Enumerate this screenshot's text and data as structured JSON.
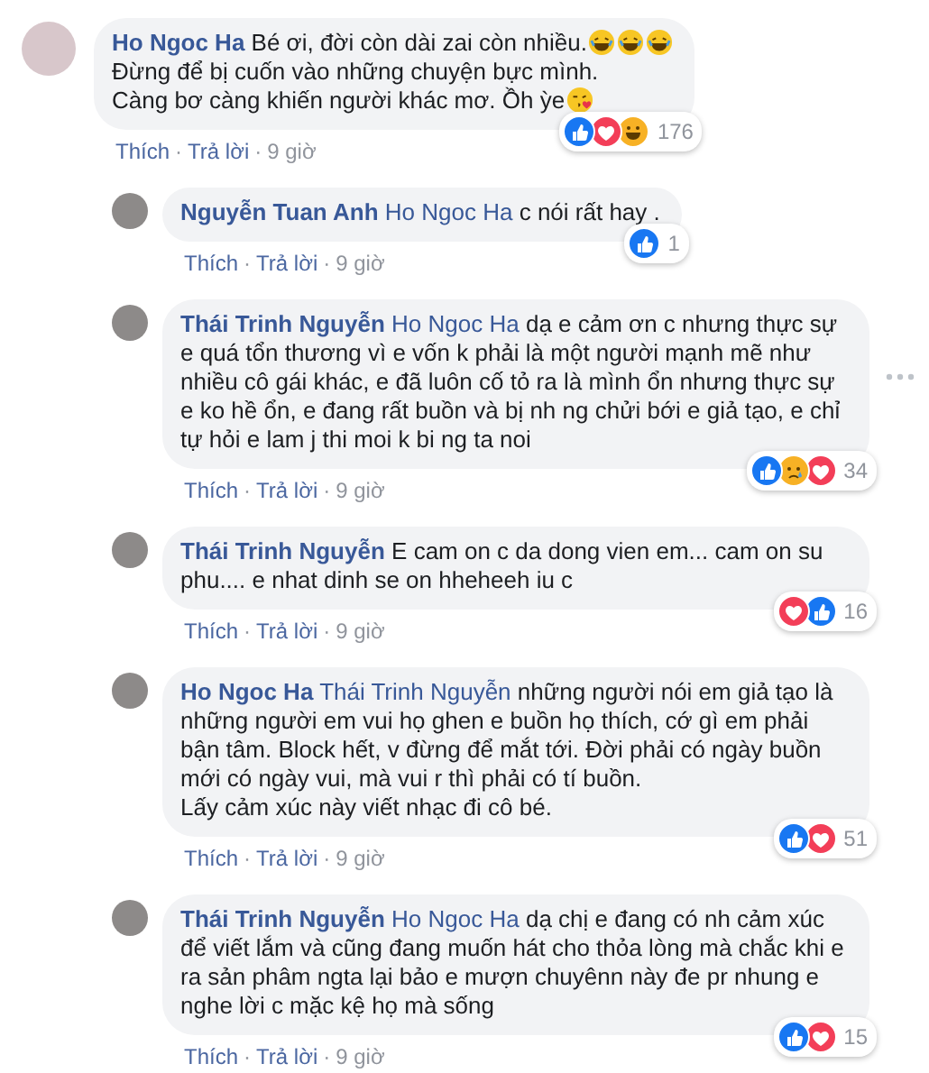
{
  "comments": [
    {
      "kind": "comment",
      "author": "Ho Ngoc Ha",
      "lines": [
        {
          "text": "Bé ơi, đời còn dài zai còn nhiều.",
          "emojis": [
            {
              "kind": "laugh"
            },
            {
              "kind": "laugh"
            },
            {
              "kind": "laugh"
            }
          ]
        },
        {
          "text": "Đừng để bị cuốn vào những chuyện bực mình."
        },
        {
          "text": "Càng bơ càng khiến người khác mơ. Ồh ỳe",
          "emojis": [
            {
              "kind": "kiss"
            }
          ]
        }
      ],
      "reactions": [
        {
          "kind": "like"
        },
        {
          "kind": "love"
        },
        {
          "kind": "haha"
        }
      ],
      "reaction_count": "176",
      "actions": [
        {
          "kind": "like",
          "text": "Thích"
        },
        {
          "kind": "dot",
          "text": "·"
        },
        {
          "kind": "reply",
          "text": "Trả lời"
        },
        {
          "kind": "dot",
          "text": "·"
        },
        {
          "kind": "time",
          "text": "9 giờ"
        }
      ]
    },
    {
      "kind": "reply",
      "author": "Nguyễn Tuan Anh",
      "mention": "Ho Ngoc Ha",
      "lines": [
        {
          "text": "c nói rất hay ."
        }
      ],
      "reactions": [
        {
          "kind": "like"
        }
      ],
      "reaction_count": "1",
      "actions": [
        {
          "kind": "like",
          "text": "Thích"
        },
        {
          "kind": "dot",
          "text": "·"
        },
        {
          "kind": "reply",
          "text": "Trả lời"
        },
        {
          "kind": "dot",
          "text": "·"
        },
        {
          "kind": "time",
          "text": "9 giờ"
        }
      ]
    },
    {
      "kind": "reply",
      "author": "Thái Trinh Nguyễn",
      "mention": "Ho Ngoc Ha",
      "lines": [
        {
          "text": "dạ e cảm ơn c nhưng thực sự e quá tổn thương vì e vốn k phải là một người mạnh mẽ như nhiều cô gái khác, e đã luôn cố tỏ ra là mình ổn nhưng thực sự e ko hề ổn, e đang rất buồn và bị nh ng chửi bới e giả tạo, e chỉ tự hỏi e lam j thi moi k bi ng ta noi"
        }
      ],
      "reactions": [
        {
          "kind": "like"
        },
        {
          "kind": "sad"
        },
        {
          "kind": "love"
        }
      ],
      "reaction_count": "34",
      "actions": [
        {
          "kind": "like",
          "text": "Thích"
        },
        {
          "kind": "dot",
          "text": "·"
        },
        {
          "kind": "reply",
          "text": "Trả lời"
        },
        {
          "kind": "dot",
          "text": "·"
        },
        {
          "kind": "time",
          "text": "9 giờ"
        }
      ],
      "more_menu": true
    },
    {
      "kind": "reply",
      "author": "Thái Trinh Nguyễn",
      "lines": [
        {
          "text": "E cam on c da dong vien em... cam on su phu.... e nhat dinh se on hheheeh iu c"
        }
      ],
      "reactions": [
        {
          "kind": "love"
        },
        {
          "kind": "like"
        }
      ],
      "reaction_count": "16",
      "actions": [
        {
          "kind": "like",
          "text": "Thích"
        },
        {
          "kind": "dot",
          "text": "·"
        },
        {
          "kind": "reply",
          "text": "Trả lời"
        },
        {
          "kind": "dot",
          "text": "·"
        },
        {
          "kind": "time",
          "text": "9 giờ"
        }
      ]
    },
    {
      "kind": "reply",
      "author": "Ho Ngoc Ha",
      "mention": "Thái Trinh Nguyễn",
      "lines": [
        {
          "text": "những người nói em giả tạo là những người em vui họ ghen e buồn họ thích, cớ gì em phải bận tâm. Block hết, v đừng để mắt tới. Đời phải có ngày buồn mới có ngày vui, mà vui r thì phải có tí buồn."
        },
        {
          "text": "Lấy cảm xúc này viết nhạc đi cô bé."
        }
      ],
      "reactions": [
        {
          "kind": "like"
        },
        {
          "kind": "love"
        }
      ],
      "reaction_count": "51",
      "actions": [
        {
          "kind": "like",
          "text": "Thích"
        },
        {
          "kind": "dot",
          "text": "·"
        },
        {
          "kind": "reply",
          "text": "Trả lời"
        },
        {
          "kind": "dot",
          "text": "·"
        },
        {
          "kind": "time",
          "text": "9 giờ"
        }
      ]
    },
    {
      "kind": "reply",
      "author": "Thái Trinh Nguyễn",
      "mention": "Ho Ngoc Ha",
      "lines": [
        {
          "text": "dạ chị e đang có nh cảm xúc để viết lắm và cũng đang muốn hát cho thỏa lòng mà chắc khi e ra sản phâm ngta lại bảo e mượn chuyênn này đe pr nhung e nghe lời c mặc kệ họ mà sống"
        }
      ],
      "reactions": [
        {
          "kind": "like"
        },
        {
          "kind": "love"
        }
      ],
      "reaction_count": "15",
      "actions": [
        {
          "kind": "like",
          "text": "Thích"
        },
        {
          "kind": "dot",
          "text": "·"
        },
        {
          "kind": "reply",
          "text": "Trả lời"
        },
        {
          "kind": "dot",
          "text": "·"
        },
        {
          "kind": "time",
          "text": "9 giờ"
        }
      ]
    }
  ]
}
